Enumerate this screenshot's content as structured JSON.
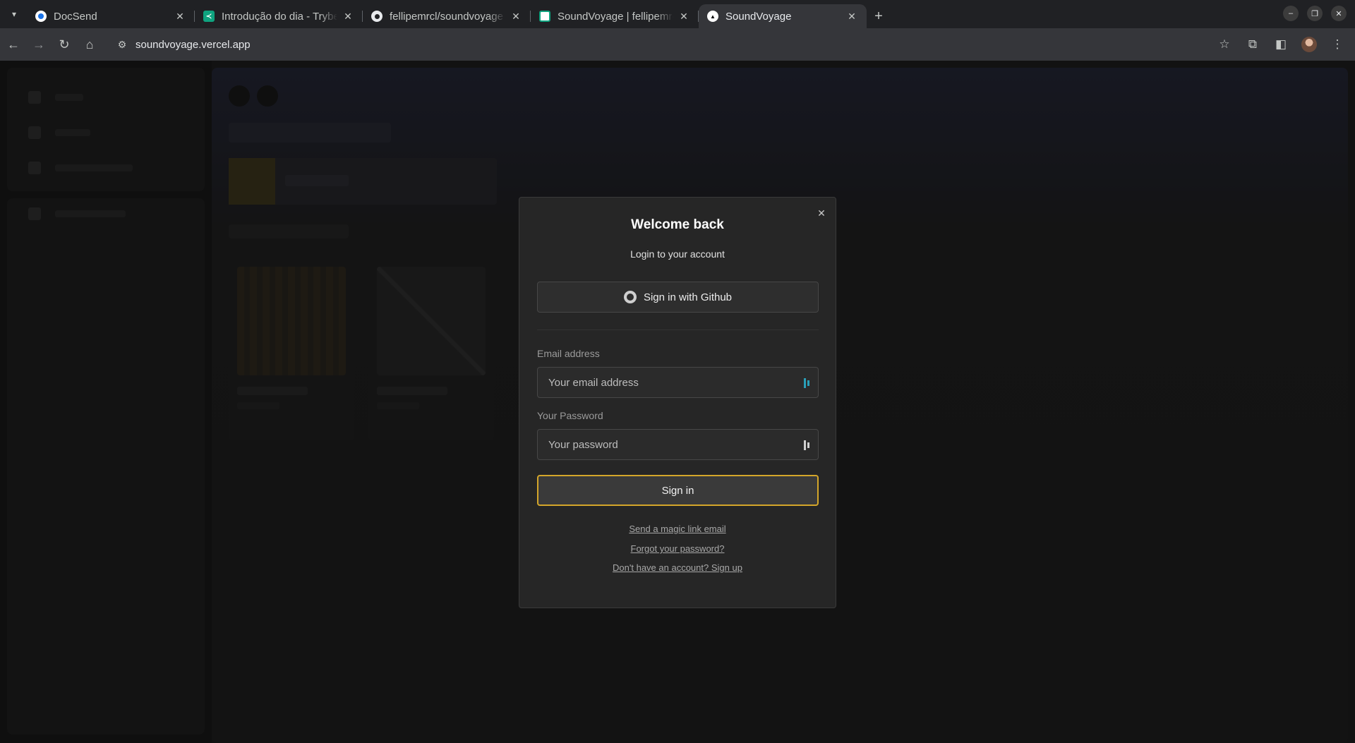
{
  "browser": {
    "tabs": [
      {
        "title": "DocSend",
        "favicon_color": "#1a73e8",
        "active": false
      },
      {
        "title": "Introdução do dia - Trybe",
        "favicon_color": "#0fa37f",
        "active": false
      },
      {
        "title": "fellipemrcl/soundvoyage",
        "favicon_color": "#ffffff",
        "active": false
      },
      {
        "title": "SoundVoyage | fellipemrcl",
        "favicon_color": "#0fa37f",
        "active": false
      },
      {
        "title": "SoundVoyage",
        "favicon_color": "#ffffff",
        "active": true
      }
    ],
    "url": "soundvoyage.vercel.app"
  },
  "modal": {
    "title": "Welcome back",
    "subtitle": "Login to your account",
    "github_button": "Sign in with Github",
    "email_label": "Email address",
    "email_placeholder": "Your email address",
    "password_label": "Your Password",
    "password_placeholder": "Your password",
    "signin_button": "Sign in",
    "magic_link": "Send a magic link email",
    "forgot_password": "Forgot your password?",
    "signup_link": "Don't have an account? Sign up"
  },
  "colors": {
    "accent_border": "#d4a62a",
    "modal_bg": "#262626",
    "background": "#171717"
  }
}
